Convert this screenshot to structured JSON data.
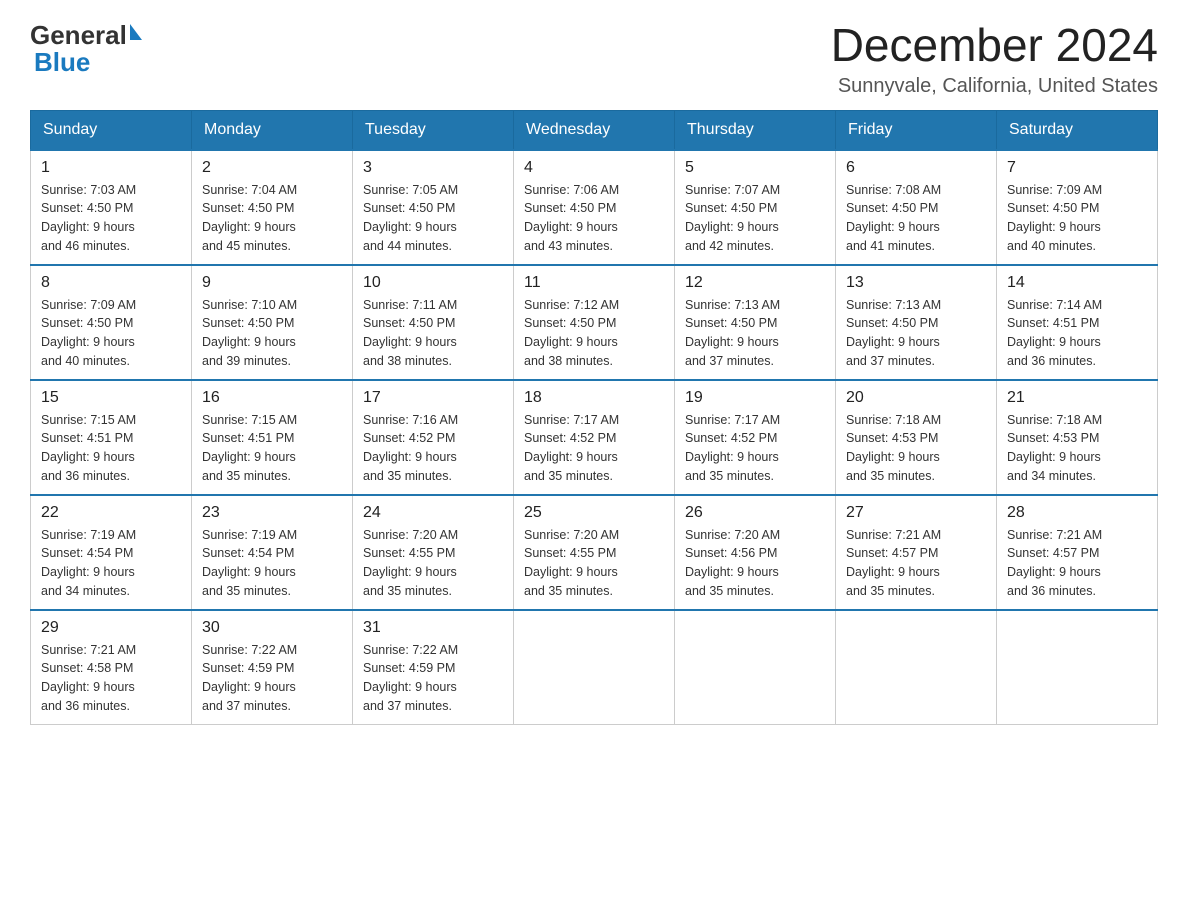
{
  "header": {
    "logo_general": "General",
    "logo_blue": "Blue",
    "main_title": "December 2024",
    "subtitle": "Sunnyvale, California, United States"
  },
  "calendar": {
    "weekdays": [
      "Sunday",
      "Monday",
      "Tuesday",
      "Wednesday",
      "Thursday",
      "Friday",
      "Saturday"
    ],
    "weeks": [
      [
        {
          "day": "1",
          "sunrise": "7:03 AM",
          "sunset": "4:50 PM",
          "daylight": "9 hours and 46 minutes."
        },
        {
          "day": "2",
          "sunrise": "7:04 AM",
          "sunset": "4:50 PM",
          "daylight": "9 hours and 45 minutes."
        },
        {
          "day": "3",
          "sunrise": "7:05 AM",
          "sunset": "4:50 PM",
          "daylight": "9 hours and 44 minutes."
        },
        {
          "day": "4",
          "sunrise": "7:06 AM",
          "sunset": "4:50 PM",
          "daylight": "9 hours and 43 minutes."
        },
        {
          "day": "5",
          "sunrise": "7:07 AM",
          "sunset": "4:50 PM",
          "daylight": "9 hours and 42 minutes."
        },
        {
          "day": "6",
          "sunrise": "7:08 AM",
          "sunset": "4:50 PM",
          "daylight": "9 hours and 41 minutes."
        },
        {
          "day": "7",
          "sunrise": "7:09 AM",
          "sunset": "4:50 PM",
          "daylight": "9 hours and 40 minutes."
        }
      ],
      [
        {
          "day": "8",
          "sunrise": "7:09 AM",
          "sunset": "4:50 PM",
          "daylight": "9 hours and 40 minutes."
        },
        {
          "day": "9",
          "sunrise": "7:10 AM",
          "sunset": "4:50 PM",
          "daylight": "9 hours and 39 minutes."
        },
        {
          "day": "10",
          "sunrise": "7:11 AM",
          "sunset": "4:50 PM",
          "daylight": "9 hours and 38 minutes."
        },
        {
          "day": "11",
          "sunrise": "7:12 AM",
          "sunset": "4:50 PM",
          "daylight": "9 hours and 38 minutes."
        },
        {
          "day": "12",
          "sunrise": "7:13 AM",
          "sunset": "4:50 PM",
          "daylight": "9 hours and 37 minutes."
        },
        {
          "day": "13",
          "sunrise": "7:13 AM",
          "sunset": "4:50 PM",
          "daylight": "9 hours and 37 minutes."
        },
        {
          "day": "14",
          "sunrise": "7:14 AM",
          "sunset": "4:51 PM",
          "daylight": "9 hours and 36 minutes."
        }
      ],
      [
        {
          "day": "15",
          "sunrise": "7:15 AM",
          "sunset": "4:51 PM",
          "daylight": "9 hours and 36 minutes."
        },
        {
          "day": "16",
          "sunrise": "7:15 AM",
          "sunset": "4:51 PM",
          "daylight": "9 hours and 35 minutes."
        },
        {
          "day": "17",
          "sunrise": "7:16 AM",
          "sunset": "4:52 PM",
          "daylight": "9 hours and 35 minutes."
        },
        {
          "day": "18",
          "sunrise": "7:17 AM",
          "sunset": "4:52 PM",
          "daylight": "9 hours and 35 minutes."
        },
        {
          "day": "19",
          "sunrise": "7:17 AM",
          "sunset": "4:52 PM",
          "daylight": "9 hours and 35 minutes."
        },
        {
          "day": "20",
          "sunrise": "7:18 AM",
          "sunset": "4:53 PM",
          "daylight": "9 hours and 35 minutes."
        },
        {
          "day": "21",
          "sunrise": "7:18 AM",
          "sunset": "4:53 PM",
          "daylight": "9 hours and 34 minutes."
        }
      ],
      [
        {
          "day": "22",
          "sunrise": "7:19 AM",
          "sunset": "4:54 PM",
          "daylight": "9 hours and 34 minutes."
        },
        {
          "day": "23",
          "sunrise": "7:19 AM",
          "sunset": "4:54 PM",
          "daylight": "9 hours and 35 minutes."
        },
        {
          "day": "24",
          "sunrise": "7:20 AM",
          "sunset": "4:55 PM",
          "daylight": "9 hours and 35 minutes."
        },
        {
          "day": "25",
          "sunrise": "7:20 AM",
          "sunset": "4:55 PM",
          "daylight": "9 hours and 35 minutes."
        },
        {
          "day": "26",
          "sunrise": "7:20 AM",
          "sunset": "4:56 PM",
          "daylight": "9 hours and 35 minutes."
        },
        {
          "day": "27",
          "sunrise": "7:21 AM",
          "sunset": "4:57 PM",
          "daylight": "9 hours and 35 minutes."
        },
        {
          "day": "28",
          "sunrise": "7:21 AM",
          "sunset": "4:57 PM",
          "daylight": "9 hours and 36 minutes."
        }
      ],
      [
        {
          "day": "29",
          "sunrise": "7:21 AM",
          "sunset": "4:58 PM",
          "daylight": "9 hours and 36 minutes."
        },
        {
          "day": "30",
          "sunrise": "7:22 AM",
          "sunset": "4:59 PM",
          "daylight": "9 hours and 37 minutes."
        },
        {
          "day": "31",
          "sunrise": "7:22 AM",
          "sunset": "4:59 PM",
          "daylight": "9 hours and 37 minutes."
        },
        null,
        null,
        null,
        null
      ]
    ],
    "labels": {
      "sunrise": "Sunrise:",
      "sunset": "Sunset:",
      "daylight": "Daylight:"
    }
  }
}
